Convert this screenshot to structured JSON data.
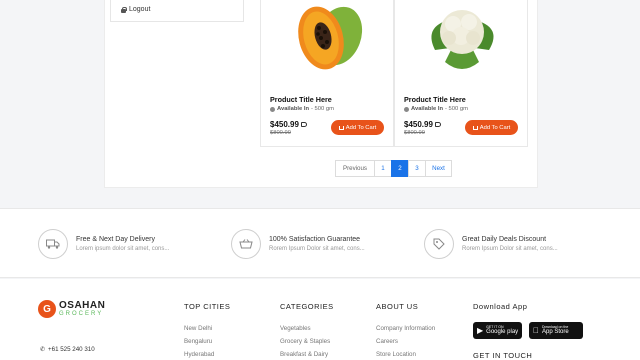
{
  "sidebar": {
    "logout_label": "Logout"
  },
  "products": [
    {
      "title": "Product Title Here",
      "avail_label": "Available In",
      "avail_value": "- 500 gm",
      "price": "$450.99",
      "old_price": "$800.99",
      "cart_label": "Add To Cart",
      "image": "papaya-image"
    },
    {
      "title": "Product Title Here",
      "avail_label": "Available In",
      "avail_value": "- 500 gm",
      "price": "$450.99",
      "old_price": "$800.99",
      "cart_label": "Add To Cart",
      "image": "cauliflower-image"
    }
  ],
  "pagination": {
    "previous": "Previous",
    "pages": [
      "1",
      "2",
      "3"
    ],
    "active": "2",
    "next": "Next"
  },
  "features": [
    {
      "icon": "truck-icon",
      "title": "Free & Next Day Delivery",
      "sub": "Lorem ipsum dolor sit amet, cons..."
    },
    {
      "icon": "basket-icon",
      "title": "100% Satisfaction Guarantee",
      "sub": "Rorem Ipsum Dolor sit amet, cons..."
    },
    {
      "icon": "tag-icon",
      "title": "Great Daily Deals Discount",
      "sub": "Rorem Ipsum Dolor sit amet, cons..."
    }
  ],
  "footer": {
    "logo_letter": "G",
    "logo_name": "OSAHAN",
    "logo_sub": "GROCERY",
    "phone": "+61 525 240 310",
    "top_cities": {
      "heading": "TOP CITIES",
      "links": [
        "New Delhi",
        "Bengaluru",
        "Hyderabad"
      ]
    },
    "categories": {
      "heading": "CATEGORIES",
      "links": [
        "Vegetables",
        "Grocery & Staples",
        "Breakfast & Dairy"
      ]
    },
    "about": {
      "heading": "ABOUT US",
      "links": [
        "Company Information",
        "Careers",
        "Store Location"
      ]
    },
    "download": {
      "heading": "Download App",
      "google_small": "GET IT ON",
      "google": "Google play",
      "apple_small": "Download on the",
      "apple": "App Store"
    },
    "get_in_touch": "GET IN TOUCH"
  },
  "colors": {
    "accent": "#e8531a",
    "link_blue": "#1a73e8",
    "green": "#5cb85c"
  }
}
